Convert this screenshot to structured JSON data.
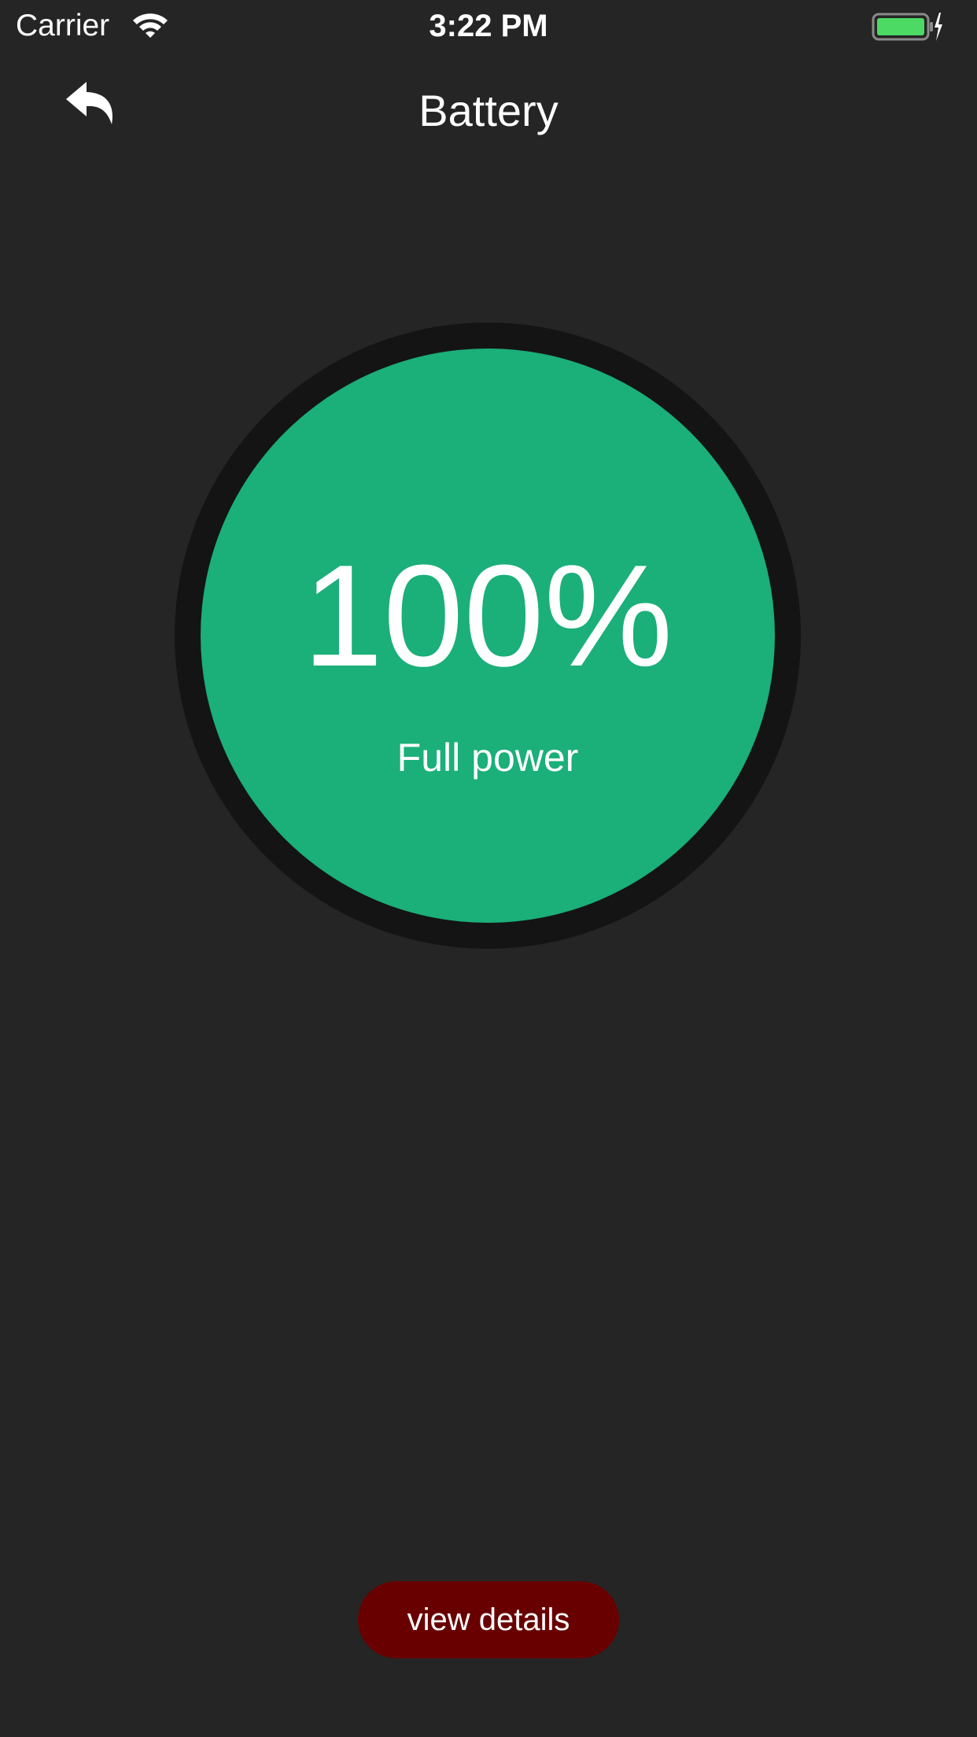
{
  "status_bar": {
    "carrier": "Carrier",
    "time": "3:22 PM",
    "wifi_icon": "wifi-icon",
    "battery_icon": "battery-full-icon",
    "charging_icon": "charging-bolt-icon",
    "battery_color": "#4cd964"
  },
  "nav": {
    "title": "Battery",
    "back_icon": "back-arrow-icon"
  },
  "gauge": {
    "percent": "100%",
    "status": "Full power",
    "level": 1.0,
    "fill_color": "#1baf7a",
    "ring_color": "#141414"
  },
  "actions": {
    "view_details_label": "view details",
    "button_color": "#690000"
  }
}
